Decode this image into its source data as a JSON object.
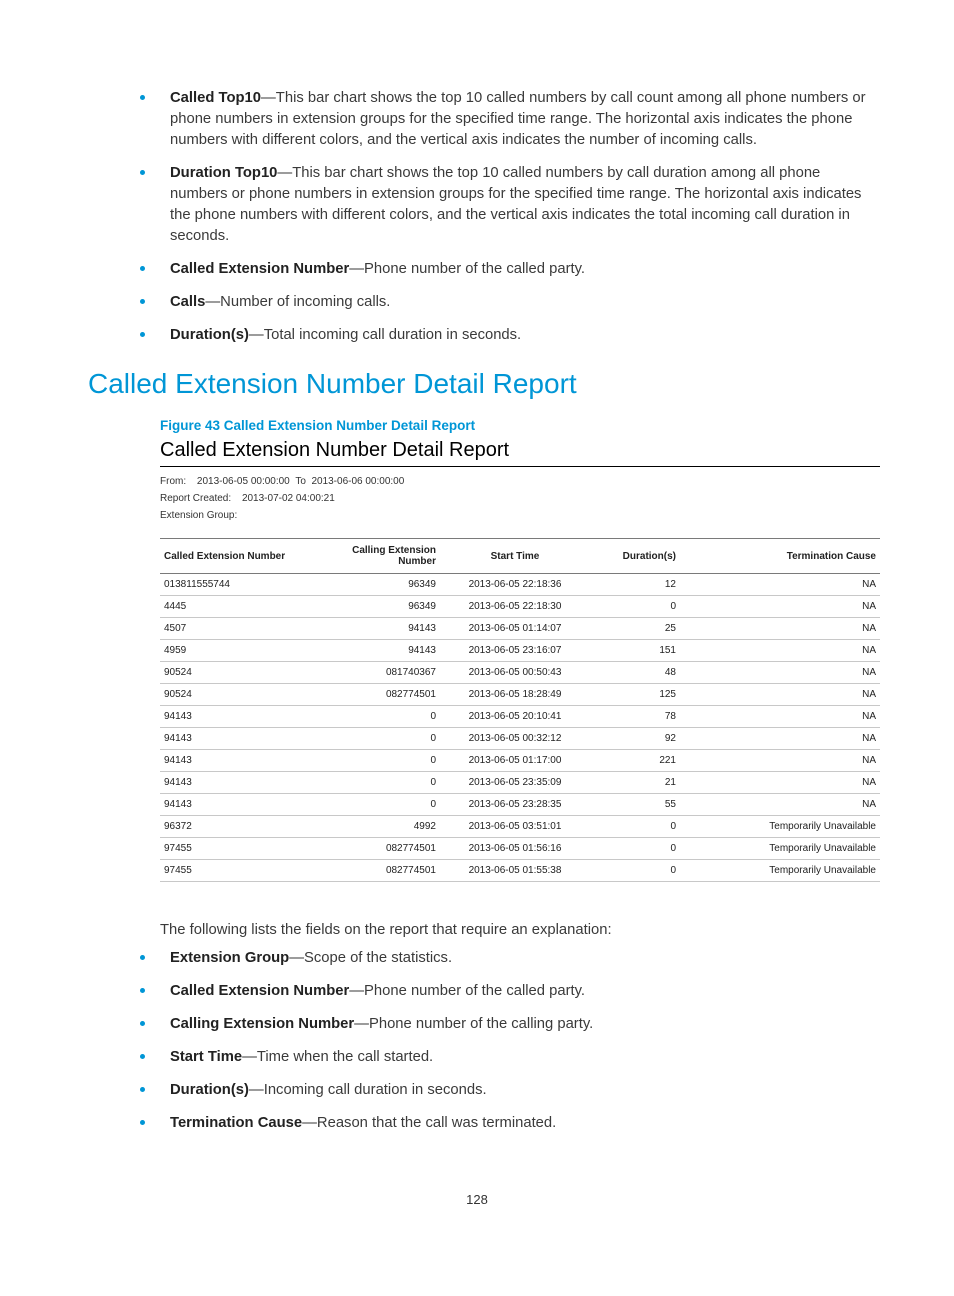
{
  "topList": [
    {
      "term": "Called Top10",
      "desc": "—This bar chart shows the top 10 called numbers by call count among all phone numbers or phone numbers in extension groups for the specified time range. The horizontal axis indicates the phone numbers with different colors, and the vertical axis indicates the number of incoming calls."
    },
    {
      "term": "Duration Top10",
      "desc": "—This bar chart shows the top 10 called numbers by call duration among all phone numbers or phone numbers in extension groups for the specified time range. The horizontal axis indicates the phone numbers with different colors, and the vertical axis indicates the total incoming call duration in seconds."
    },
    {
      "term": "Called Extension Number",
      "desc": "—Phone number of the called party."
    },
    {
      "term": "Calls",
      "desc": "—Number of incoming calls."
    },
    {
      "term": "Duration(s)",
      "desc": "—Total incoming call duration in seconds."
    }
  ],
  "heading": "Called Extension Number Detail Report",
  "figureCaption": "Figure 43 Called Extension Number Detail Report",
  "report": {
    "title": "Called Extension Number Detail Report",
    "fromLabel": "From:",
    "fromValue": "2013-06-05 00:00:00",
    "toLabel": "To",
    "toValue": "2013-06-06 00:00:00",
    "createdLabel": "Report Created:",
    "createdValue": "2013-07-02 04:00:21",
    "extGroupLabel": "Extension Group:",
    "extGroupValue": "",
    "headers": [
      "Called Extension Number",
      "Calling Extension Number",
      "Start Time",
      "Duration(s)",
      "Termination Cause"
    ],
    "rows": [
      [
        "013811555744",
        "96349",
        "2013-06-05 22:18:36",
        "12",
        "NA"
      ],
      [
        "4445",
        "96349",
        "2013-06-05 22:18:30",
        "0",
        "NA"
      ],
      [
        "4507",
        "94143",
        "2013-06-05 01:14:07",
        "25",
        "NA"
      ],
      [
        "4959",
        "94143",
        "2013-06-05 23:16:07",
        "151",
        "NA"
      ],
      [
        "90524",
        "081740367",
        "2013-06-05 00:50:43",
        "48",
        "NA"
      ],
      [
        "90524",
        "082774501",
        "2013-06-05 18:28:49",
        "125",
        "NA"
      ],
      [
        "94143",
        "0",
        "2013-06-05 20:10:41",
        "78",
        "NA"
      ],
      [
        "94143",
        "0",
        "2013-06-05 00:32:12",
        "92",
        "NA"
      ],
      [
        "94143",
        "0",
        "2013-06-05 01:17:00",
        "221",
        "NA"
      ],
      [
        "94143",
        "0",
        "2013-06-05 23:35:09",
        "21",
        "NA"
      ],
      [
        "94143",
        "0",
        "2013-06-05 23:28:35",
        "55",
        "NA"
      ],
      [
        "96372",
        "4992",
        "2013-06-05 03:51:01",
        "0",
        "Temporarily Unavailable"
      ],
      [
        "97455",
        "082774501",
        "2013-06-05 01:56:16",
        "0",
        "Temporarily Unavailable"
      ],
      [
        "97455",
        "082774501",
        "2013-06-05 01:55:38",
        "0",
        "Temporarily Unavailable"
      ]
    ]
  },
  "bodyText": "The following lists the fields on the report that require an explanation:",
  "bottomList": [
    {
      "term": "Extension Group",
      "desc": "—Scope of the statistics."
    },
    {
      "term": "Called Extension Number",
      "desc": "—Phone number of the called party."
    },
    {
      "term": "Calling Extension Number",
      "desc": "—Phone number of the calling party."
    },
    {
      "term": "Start Time",
      "desc": "—Time when the call started."
    },
    {
      "term": "Duration(s)",
      "desc": "—Incoming call duration in seconds."
    },
    {
      "term": "Termination Cause",
      "desc": "—Reason that the call was terminated."
    }
  ],
  "pageNumber": "128"
}
